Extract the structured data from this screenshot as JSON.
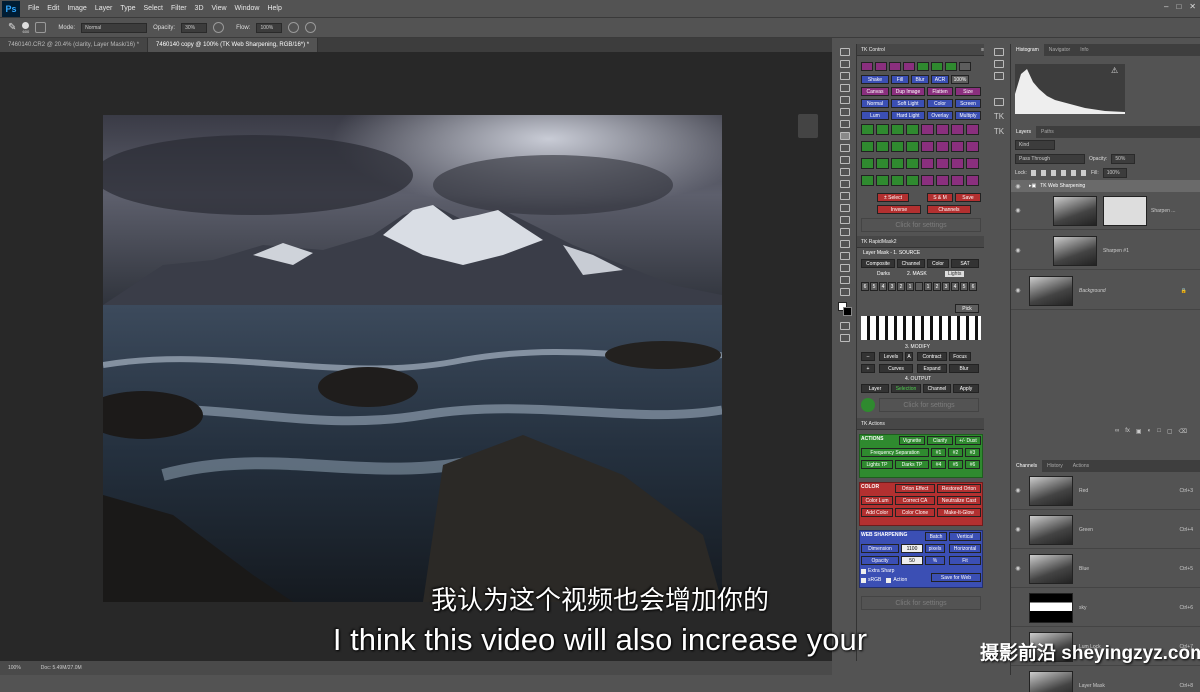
{
  "app": {
    "logo": "Ps"
  },
  "menu": [
    "File",
    "Edit",
    "Image",
    "Layer",
    "Type",
    "Select",
    "Filter",
    "3D",
    "View",
    "Window",
    "Help"
  ],
  "options": {
    "brush_size": "600",
    "mode_label": "Mode:",
    "mode_value": "Normal",
    "opacity_label": "Opacity:",
    "opacity_value": "30%",
    "flow_label": "Flow:",
    "flow_value": "100%"
  },
  "tabs": [
    {
      "label": "7460140.CR2 @ 20.4% (clarity, Layer Mask/16) *"
    },
    {
      "label": "7460140 copy @ 100% (TK Web Sharpening, RGB/16*) *"
    }
  ],
  "status": {
    "zoom": "100%",
    "doc": "Doc: 5.49M/27.0M"
  },
  "tk_control": {
    "title": "TK Control",
    "row1": [
      "Shake",
      "Fill",
      "Blur",
      "ACR",
      "100%"
    ],
    "row2": [
      "Canvas",
      "Dup Image",
      "Flatten",
      "Size"
    ],
    "row3": [
      "Normal",
      "Soft Light",
      "Color",
      "Screen"
    ],
    "row4": [
      "Lum",
      "Hard Light",
      "Overlay",
      "Multiply"
    ],
    "select": "± Select",
    "sm": "S & M",
    "save": "Save",
    "inverse": "Inverse",
    "channels": "Channels",
    "click": "Click for settings"
  },
  "rapidmask": {
    "title": "TK RapidMask2",
    "source_title": "Layer Mask - 1. SOURCE",
    "source": [
      "Composite",
      "Channel",
      "Color",
      "SAT"
    ],
    "mask_title": "2. MASK",
    "darks": "Darks",
    "lights": "Lights",
    "zones": [
      "6",
      "5",
      "4",
      "3",
      "2",
      "1",
      "",
      "1",
      "2",
      "3",
      "4",
      "5",
      "6"
    ],
    "pick": "Pick",
    "modify_title": "3. MODIFY",
    "modify": [
      "Levels",
      "A",
      "Contract",
      "Focus",
      "Curves",
      "Expand",
      "Blur"
    ],
    "output_title": "4. OUTPUT",
    "output": [
      "Layer",
      "Selection",
      "Channel",
      "Apply"
    ],
    "click": "Click for settings"
  },
  "tk_actions": {
    "title": "TK Actions",
    "actions_label": "ACTIONS",
    "actions": [
      "Vignette",
      "Clarify",
      "+/- Dust",
      "Frequency Separation",
      "#1",
      "#2",
      "#3",
      "Lights TP",
      "Darks TP",
      "#4",
      "#5",
      "#6"
    ],
    "color_label": "COLOR",
    "color": [
      "Orton Effect",
      "Restored Orton",
      "Color Lum",
      "Correct CA",
      "Neutralize Cast",
      "Add Color",
      "Color Clone",
      "Make-It-Glow"
    ],
    "web_label": "WEB SHARPENING",
    "batch": "Batch",
    "vertical": "Vertical",
    "dimension_label": "Dimension",
    "dimension_value": "1100",
    "pixels": "pixels",
    "horizontal": "Horizontal",
    "opacity_label": "Opacity",
    "opacity_value": "50",
    "percent": "%",
    "fit": "Fit",
    "extra_sharp": "Extra Sharp",
    "srgb": "sRGB",
    "action": "Action",
    "save_web": "Save for Web",
    "click": "Click for settings"
  },
  "histogram_tabs": [
    "Histogram",
    "Navigator",
    "Info"
  ],
  "layers_panel": {
    "tabs": [
      "Layers",
      "Paths"
    ],
    "kind": "Kind",
    "blend": "Pass Through",
    "opacity_label": "Opacity:",
    "opacity_value": "50%",
    "lock_label": "Lock:",
    "fill_label": "Fill:",
    "fill_value": "100%",
    "layers": [
      {
        "name": "TK Web Sharpening"
      },
      {
        "name": "Sharpen ..."
      },
      {
        "name": "Sharpen #1"
      },
      {
        "name": "Background"
      }
    ]
  },
  "channels_panel": {
    "tabs": [
      "Channels",
      "History",
      "Actions"
    ],
    "rows": [
      {
        "name": "Red",
        "shortcut": "Ctrl+3"
      },
      {
        "name": "Green",
        "shortcut": "Ctrl+4"
      },
      {
        "name": "Blue",
        "shortcut": "Ctrl+5"
      },
      {
        "name": "sky",
        "shortcut": "Ctrl+6"
      },
      {
        "name": "Lum Lock",
        "shortcut": "Ctrl+7"
      },
      {
        "name": "Layer Mask",
        "shortcut": "Ctrl+8"
      }
    ]
  },
  "subtitle": {
    "cn": "我认为这个视频也会增加你的",
    "en": "I think this video will also increase your"
  },
  "watermark": "摄影前沿 sheyingzyz.com",
  "colors": {
    "accent": "#31a8ff",
    "pink": "#8a2f7e",
    "blue": "#3b4fb4",
    "green": "#2f8a2f",
    "red": "#b33030"
  }
}
